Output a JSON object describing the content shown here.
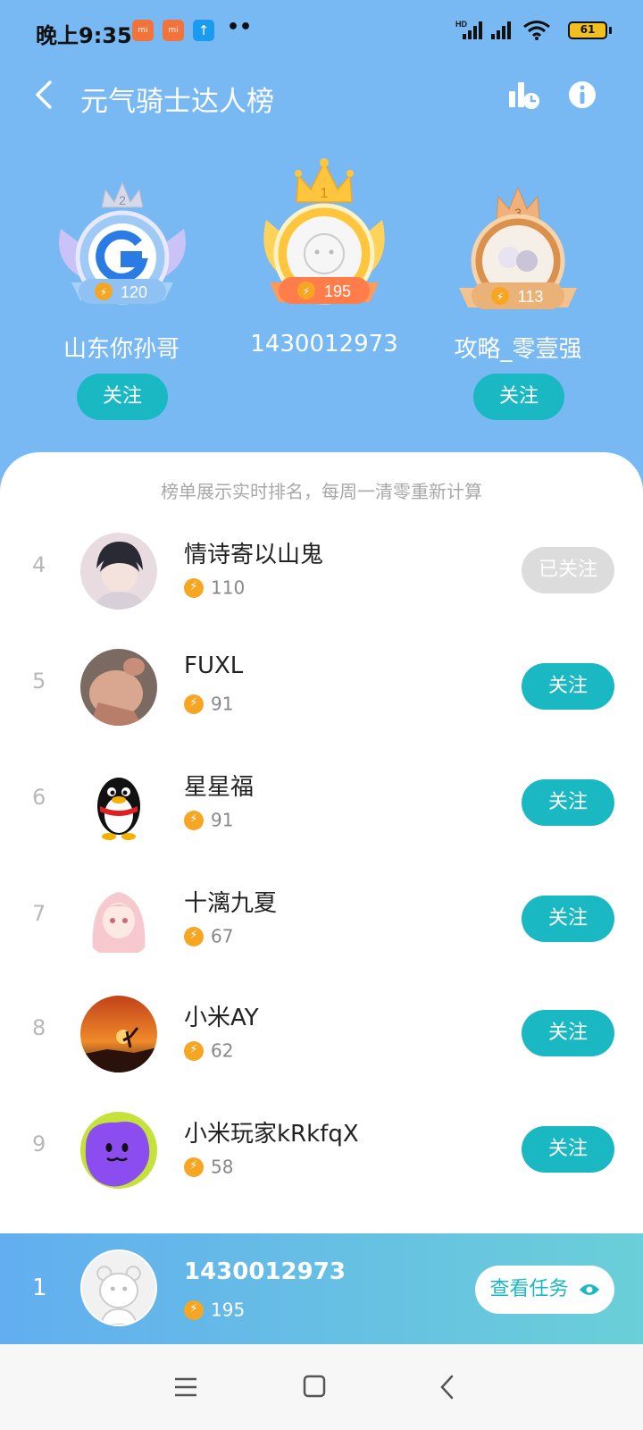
{
  "status_bar": {
    "time": "晚上9:35",
    "notifications": [
      "mi",
      "mi",
      "↑"
    ],
    "more": "••",
    "hd_label": "HD",
    "battery": "61"
  },
  "header": {
    "title": "元气骑士达人榜",
    "icons": [
      "back-arrow-icon",
      "stats-icon",
      "info-icon"
    ]
  },
  "podium": [
    {
      "rank": "2",
      "name": "山东你孙哥",
      "score": "120",
      "follow_label": "关注",
      "color": "#b9b6f5"
    },
    {
      "rank": "1",
      "name": "1430012973",
      "score": "195",
      "follow_label": "",
      "color": "#ffc53d"
    },
    {
      "rank": "3",
      "name": "攻略_零壹强",
      "score": "113",
      "follow_label": "关注",
      "color": "#e7a86a"
    }
  ],
  "notice": "榜单展示实时排名，每周一清零重新计算",
  "list": [
    {
      "rank": "4",
      "name": "情诗寄以山鬼",
      "score": "110",
      "button": "已关注",
      "followed": true,
      "avatar": "anime-boy-avatar"
    },
    {
      "rank": "5",
      "name": "FUXL",
      "score": "91",
      "button": "关注",
      "followed": false,
      "avatar": "hand-avatar"
    },
    {
      "rank": "6",
      "name": "星星福",
      "score": "91",
      "button": "关注",
      "followed": false,
      "avatar": "penguin-avatar"
    },
    {
      "rank": "7",
      "name": "十漓九夏",
      "score": "67",
      "button": "关注",
      "followed": false,
      "avatar": "anime-girl-avatar"
    },
    {
      "rank": "8",
      "name": "小米AY",
      "score": "62",
      "button": "关注",
      "followed": false,
      "avatar": "sunset-avatar"
    },
    {
      "rank": "9",
      "name": "小米玩家kRkfqX",
      "score": "58",
      "button": "关注",
      "followed": false,
      "avatar": "purple-blob-avatar"
    }
  ],
  "my_rank": {
    "rank": "1",
    "name": "1430012973",
    "score": "195",
    "button": "查看任务"
  },
  "colors": {
    "background": "#78b9f4",
    "accent": "#1ab8c2",
    "score_icon": "#f6a623"
  }
}
